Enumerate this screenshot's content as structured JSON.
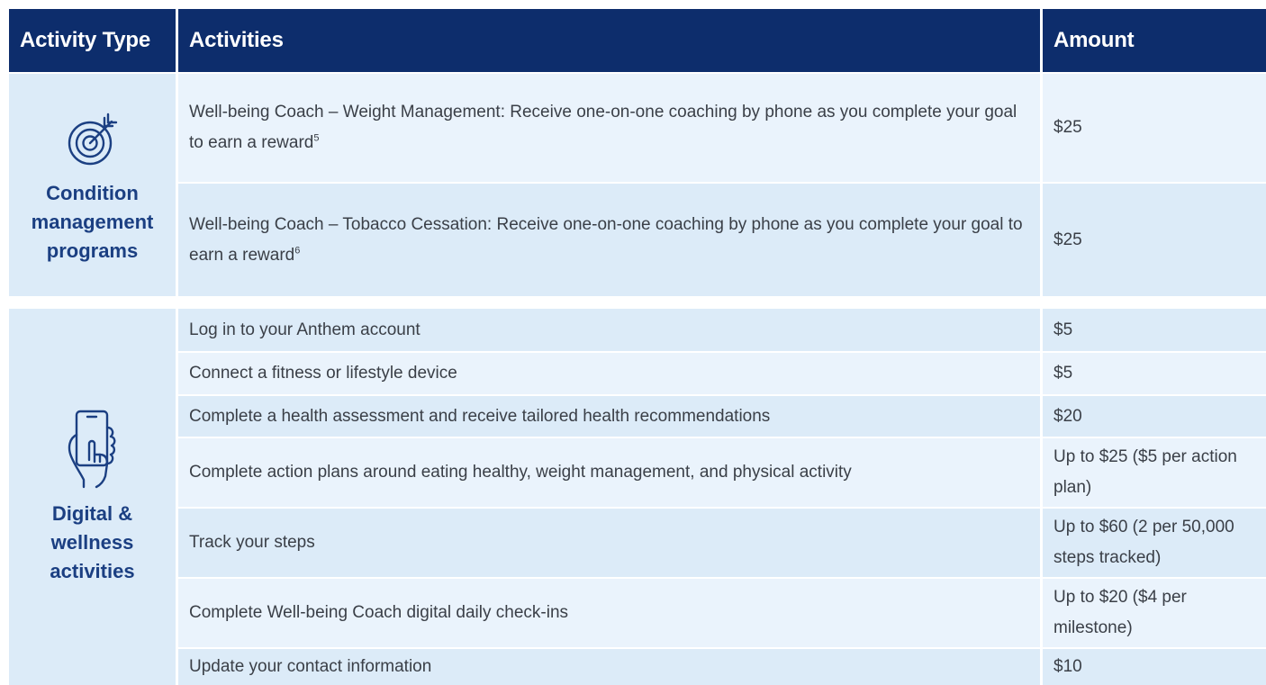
{
  "header": {
    "type": "Activity Type",
    "activities": "Activities",
    "amount": "Amount"
  },
  "groups": [
    {
      "icon": "target-icon",
      "label": "Condition management programs",
      "rows": [
        {
          "text": "Well-being Coach – Weight Management: Receive one-on-one coaching by phone as you complete your goal to earn a reward",
          "sup": "5",
          "amount": "$25"
        },
        {
          "text": "Well-being Coach – Tobacco Cessation: Receive one-on-one coaching by phone as you complete your goal to earn a reward",
          "sup": "6",
          "amount": "$25"
        }
      ]
    },
    {
      "icon": "hand-phone-icon",
      "label": "Digital & wellness activities",
      "rows": [
        {
          "text": "Log in to your Anthem account",
          "amount": "$5"
        },
        {
          "text": "Connect a fitness or lifestyle device",
          "amount": "$5"
        },
        {
          "text": "Complete a health assessment and receive tailored health recommendations",
          "amount": "$20"
        },
        {
          "text": "Complete action plans around eating healthy, weight management, and physical activity",
          "amount": "Up to $25 ($5 per action plan)"
        },
        {
          "text": "Track your steps",
          "amount": "Up to $60 (2 per 50,000 steps tracked)"
        },
        {
          "text": "Complete Well-being Coach digital daily check-ins",
          "amount": "Up to $20 ($4 per milestone)"
        },
        {
          "text": "Update your contact information",
          "amount": "$10"
        }
      ]
    }
  ],
  "colors": {
    "header_bg": "#0d2d6c",
    "label_blue": "#1b3f82",
    "row_dark": "#dcebf8",
    "row_light": "#eaf3fc"
  }
}
